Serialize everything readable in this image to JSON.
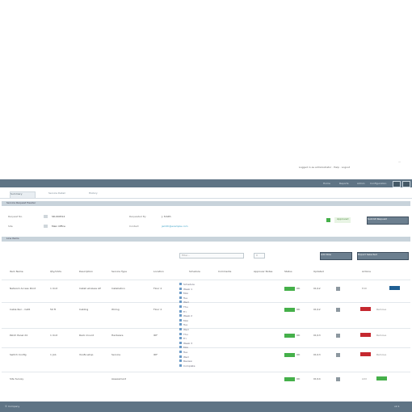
{
  "window": {
    "meta_line": "Logged in as administrator · Help · Logout",
    "dash": "—"
  },
  "topbar": {
    "links": [
      "Home",
      "Reports",
      "Admin",
      "Configuration"
    ],
    "search_label": "Go"
  },
  "subnav": {
    "tabs": [
      "Summary",
      "Service Detail",
      "History"
    ]
  },
  "header_panel": {
    "title": "Service Request Header",
    "fields": [
      {
        "label": "Request No.",
        "value": "SR-004512"
      },
      {
        "label": "Site",
        "value": "Main Office"
      },
      {
        "label": "Requested By",
        "value": "J. Smith"
      },
      {
        "label": "Contact",
        "value": "jsmith@example.com"
      }
    ],
    "status": "Approved",
    "action_label": "Submit Request"
  },
  "section": {
    "title": "Line Items"
  },
  "toolbar": {
    "filter_placeholder": "Filter…",
    "count_label": "0",
    "btn_add": "Add Row",
    "btn_export": "Export Selected"
  },
  "grid": {
    "headers": [
      "Item Name",
      "Qty/Units",
      "Description",
      "Service Type",
      "Location",
      "Schedule",
      "Comments",
      "Approver Notes",
      "Status",
      "Updated",
      "",
      "Actions"
    ],
    "rows": [
      {
        "item": "Network Access Point",
        "qty": "1 Unit",
        "desc": "Install wireless AP",
        "stype": "Installation",
        "loc": "Floor 2",
        "status": "OK",
        "date": "01/12",
        "action": "Edit"
      },
      {
        "item": "Cable Run - Cat6",
        "qty": "50 ft",
        "desc": "Cabling",
        "stype": "Wiring",
        "loc": "Floor 2",
        "status": "OK",
        "date": "01/12",
        "action": "Remove"
      },
      {
        "item": "Patch Panel 24",
        "qty": "1 Unit",
        "desc": "Rack mount",
        "stype": "Hardware",
        "loc": "IDF",
        "status": "OK",
        "date": "01/13",
        "action": "Remove"
      },
      {
        "item": "Switch Config",
        "qty": "1 Job",
        "desc": "VLAN setup",
        "stype": "Service",
        "loc": "IDF",
        "status": "OK",
        "date": "01/13",
        "action": "Remove"
      },
      {
        "item": "Site Survey",
        "qty": "",
        "desc": "",
        "stype": "Assessment",
        "loc": "",
        "status": "OK",
        "date": "01/14",
        "action": "Add"
      }
    ],
    "tree_items": [
      "Schedule",
      "Week 1",
      "Mon",
      "Tue",
      "Wed",
      "Thu",
      "Fri",
      "Week 2",
      "Mon",
      "Tue",
      "Wed",
      "Thu",
      "Fri",
      "Week 3",
      "Mon",
      "Tue",
      "Wed",
      "Review",
      "Complete"
    ]
  },
  "footer": {
    "left": "© Company",
    "right": "v2.1"
  }
}
